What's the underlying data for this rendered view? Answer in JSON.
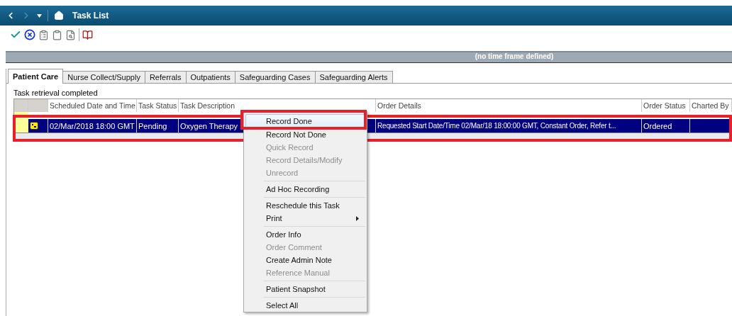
{
  "window": {
    "title": "Task List"
  },
  "timeframe": "(no time frame defined)",
  "tabs": [
    {
      "label": "Patient Care",
      "selected": true
    },
    {
      "label": "Nurse Collect/Supply",
      "selected": false
    },
    {
      "label": "Referrals",
      "selected": false
    },
    {
      "label": "Outpatients",
      "selected": false
    },
    {
      "label": "Safeguarding Cases",
      "selected": false
    },
    {
      "label": "Safeguarding Alerts",
      "selected": false
    }
  ],
  "status": "Task retrieval completed",
  "table": {
    "columns": [
      "Scheduled Date and Time",
      "Task Status",
      "Task Description",
      "Order Details",
      "Order Status",
      "Charted By"
    ],
    "rows": [
      {
        "selected": true,
        "cells": [
          "02/Mar/2018   18:00 GMT",
          "Pending",
          "Oxygen Therapy",
          "Requested Start Date/Time 02/Mar/18 18:00:00 GMT, Constant Order, Refer t...",
          "Ordered",
          ""
        ]
      }
    ]
  },
  "context_menu": {
    "groups": [
      [
        {
          "label": "Record Done",
          "disabled": false,
          "selected": true
        },
        {
          "label": "Record Not Done",
          "disabled": false,
          "selected": false
        },
        {
          "label": "Quick Record",
          "disabled": true,
          "selected": false
        },
        {
          "label": "Record Details/Modify",
          "disabled": true,
          "selected": false
        },
        {
          "label": "Unrecord",
          "disabled": true,
          "selected": false
        }
      ],
      [
        {
          "label": "Ad Hoc Recording",
          "disabled": false,
          "selected": false
        }
      ],
      [
        {
          "label": "Reschedule this Task",
          "disabled": false,
          "selected": false
        },
        {
          "label": "Print",
          "disabled": false,
          "selected": false,
          "submenu": true
        }
      ],
      [
        {
          "label": "Order Info",
          "disabled": false,
          "selected": false
        },
        {
          "label": "Order Comment",
          "disabled": true,
          "selected": false
        },
        {
          "label": "Create Admin Note",
          "disabled": false,
          "selected": false
        },
        {
          "label": "Reference Manual",
          "disabled": true,
          "selected": false
        }
      ],
      [
        {
          "label": "Patient Snapshot",
          "disabled": false,
          "selected": false
        }
      ],
      [
        {
          "label": "Select All",
          "disabled": false,
          "selected": false
        }
      ]
    ]
  }
}
